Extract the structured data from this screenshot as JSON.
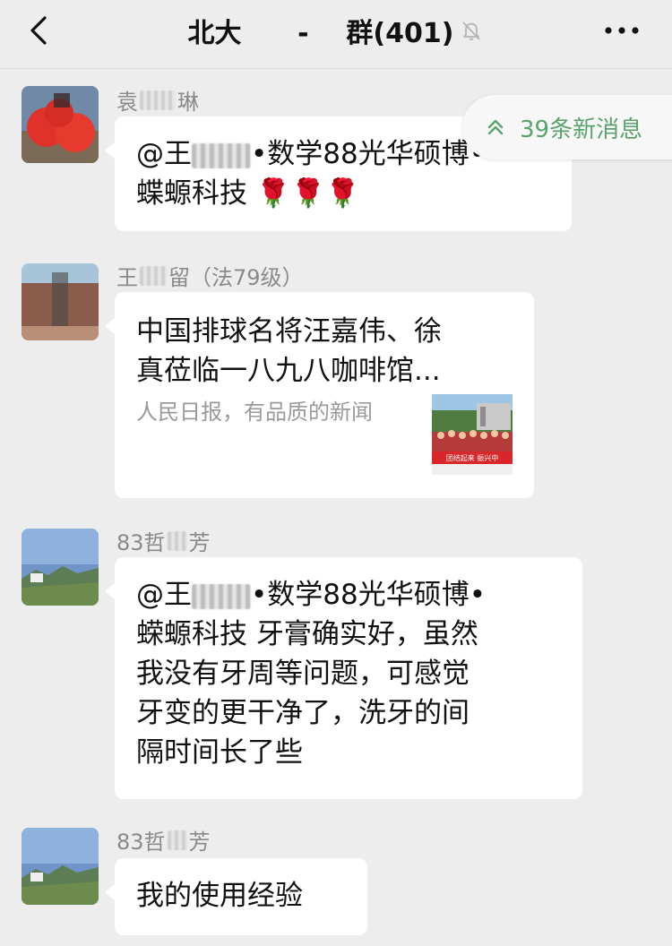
{
  "header": {
    "title": "北大      -    群(401)",
    "back_icon": "chevron-left-icon",
    "mute_icon": "bell-off-icon",
    "more_icon": "more-dots-icon"
  },
  "new_messages": {
    "label": "39条新消息",
    "icon": "double-chevron-up-icon",
    "color": "#5aa36c"
  },
  "messages": [
    {
      "sender_prefix": "袁",
      "sender_suffix": "琳",
      "lines": [
        {
          "before": "@王",
          "after": "•数学88光华硕博•"
        },
        {
          "text": "蝶螈科技 🌹🌹🌹"
        }
      ]
    },
    {
      "sender_prefix": "王",
      "sender_suffix": "留（法79级）",
      "card": {
        "title_line1": "中国排球名将汪嘉伟、徐",
        "title_line2": "真莅临一八九八咖啡馆...",
        "source": "人民日报，有品质的新闻",
        "banner": "团结起来 振兴中"
      }
    },
    {
      "sender_prefix": "83哲",
      "sender_suffix": "芳",
      "lines": [
        {
          "before": "@王",
          "after": "•数学88光华硕博•"
        },
        {
          "text": "蝾螈科技 牙膏确实好，虽然"
        },
        {
          "text": "我没有牙周等问题，可感觉"
        },
        {
          "text": "牙变的更干净了，洗牙的间"
        },
        {
          "text": "隔时间长了些"
        }
      ]
    },
    {
      "sender_prefix": "83哲",
      "sender_suffix": "芳",
      "lines": [
        {
          "text": "我的使用经验"
        }
      ]
    }
  ],
  "colors": {
    "background": "#ededed",
    "bubble": "#ffffff",
    "sender_name": "#8a8a8a",
    "accent_green": "#5aa36c"
  }
}
